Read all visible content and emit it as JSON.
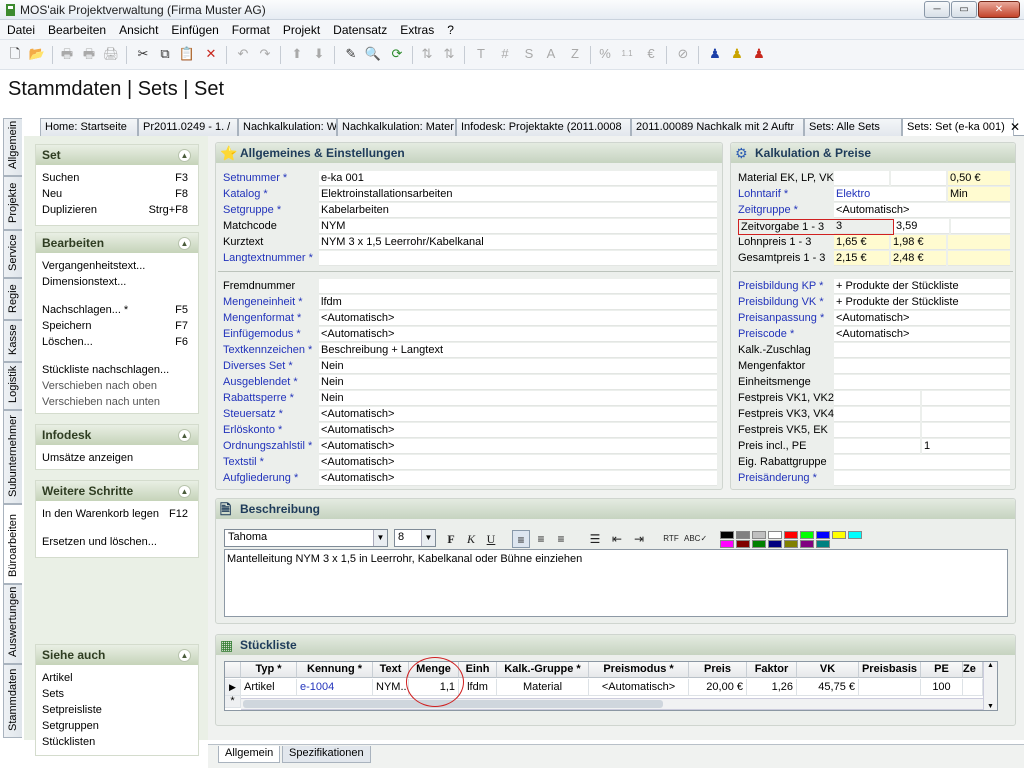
{
  "window": {
    "title": "MOS'aik Projektverwaltung (Firma Muster AG)"
  },
  "menu": [
    "Datei",
    "Bearbeiten",
    "Ansicht",
    "Einfügen",
    "Format",
    "Projekt",
    "Datensatz",
    "Extras",
    "?"
  ],
  "page": {
    "title": "Stammdaten | Sets | Set"
  },
  "tabs": [
    "Home: Startseite",
    "Pr2011.0249 - 1. /",
    "Nachkalkulation: W",
    "Nachkalkulation: Mater",
    "Infodesk: Projektakte (2011.0008",
    "2011.00089 Nachkalk mit 2 Auftr",
    "Sets: Alle Sets",
    "Sets: Set (e-ka 001)"
  ],
  "vtabs": [
    "Allgemein",
    "Projekte",
    "Service",
    "Regie",
    "Kasse",
    "Logistik",
    "Subunternehmer",
    "Büroarbeiten",
    "Auswertungen",
    "Stammdaten"
  ],
  "left": {
    "set": {
      "title": "Set",
      "items": [
        {
          "label": "Suchen",
          "key": "F3"
        },
        {
          "label": "Neu",
          "key": "F8"
        },
        {
          "label": "Duplizieren",
          "key": "Strg+F8"
        }
      ]
    },
    "bearbeiten": {
      "title": "Bearbeiten",
      "items": [
        {
          "label": "Vergangenheitstext...",
          "key": ""
        },
        {
          "label": "Dimensionstext...",
          "key": ""
        },
        {
          "label": "Nachschlagen... *",
          "key": "F5"
        },
        {
          "label": "Speichern",
          "key": "F7"
        },
        {
          "label": "Löschen...",
          "key": "F6"
        },
        {
          "label": "Stückliste nachschlagen...",
          "key": ""
        },
        {
          "label": "Verschieben nach oben",
          "key": ""
        },
        {
          "label": "Verschieben nach unten",
          "key": ""
        }
      ]
    },
    "infodesk": {
      "title": "Infodesk",
      "items": [
        {
          "label": "Umsätze anzeigen",
          "key": ""
        }
      ]
    },
    "weitere": {
      "title": "Weitere Schritte",
      "items": [
        {
          "label": "In den Warenkorb legen",
          "key": "F12"
        },
        {
          "label": "Ersetzen und löschen...",
          "key": ""
        }
      ]
    },
    "siehe": {
      "title": "Siehe auch",
      "items": [
        {
          "label": "Artikel"
        },
        {
          "label": "Sets"
        },
        {
          "label": "Setpreisliste"
        },
        {
          "label": "Setgruppen"
        },
        {
          "label": "Stücklisten"
        }
      ]
    }
  },
  "allgemein": {
    "title": "Allgemeines & Einstellungen",
    "group1": [
      {
        "label": "Setnummer *",
        "value": "e-ka 001"
      },
      {
        "label": "Katalog *",
        "value": "Elektroinstallationsarbeiten"
      },
      {
        "label": "Setgruppe *",
        "value": "Kabelarbeiten"
      },
      {
        "label": "Matchcode",
        "value": "NYM"
      },
      {
        "label": "Kurztext",
        "value": "NYM 3 x 1,5 Leerrohr/Kabelkanal"
      },
      {
        "label": "Langtextnummer *",
        "value": ""
      }
    ],
    "group2": [
      {
        "label": "Fremdnummer",
        "value": ""
      },
      {
        "label": "Mengeneinheit *",
        "value": "lfdm"
      },
      {
        "label": "Mengenformat *",
        "value": "<Automatisch>"
      },
      {
        "label": "Einfügemodus *",
        "value": "<Automatisch>"
      },
      {
        "label": "Textkennzeichen *",
        "value": "Beschreibung + Langtext"
      },
      {
        "label": "Diverses Set *",
        "value": "Nein"
      },
      {
        "label": "Ausgeblendet *",
        "value": "Nein"
      },
      {
        "label": "Rabattsperre *",
        "value": "Nein"
      },
      {
        "label": "Steuersatz *",
        "value": "<Automatisch>"
      },
      {
        "label": "Erlöskonto *",
        "value": "<Automatisch>"
      },
      {
        "label": "Ordnungszahlstil *",
        "value": "<Automatisch>"
      },
      {
        "label": "Textstil *",
        "value": "<Automatisch>"
      },
      {
        "label": "Aufgliederung *",
        "value": "<Automatisch>"
      }
    ]
  },
  "kalk": {
    "title": "Kalkulation & Preise",
    "material_label": "Material EK, LP, VK",
    "material_vk": "0,50 €",
    "lohntarif_label": "Lohntarif *",
    "lohntarif_value": "Elektro",
    "lohntarif_unit": "Min",
    "zeitgruppe_label": "Zeitgruppe *",
    "zeitgruppe_value": "<Automatisch>",
    "zeitvorgabe_label": "Zeitvorgabe 1 - 3",
    "zeitvorgabe_1": "3",
    "zeitvorgabe_2": "3,59",
    "lohnpreis_label": "Lohnpreis 1 - 3",
    "lohnpreis_1": "1,65 €",
    "lohnpreis_2": "1,98 €",
    "gesamtpreis_label": "Gesamtpreis 1 - 3",
    "gesamtpreis_1": "2,15 €",
    "gesamtpreis_2": "2,48 €",
    "group2": [
      {
        "label": "Preisbildung KP *",
        "value": "+ Produkte der Stückliste"
      },
      {
        "label": "Preisbildung VK *",
        "value": "+ Produkte der Stückliste"
      },
      {
        "label": "Preisanpassung *",
        "value": "<Automatisch>"
      },
      {
        "label": "Preiscode *",
        "value": "<Automatisch>"
      },
      {
        "label": "Kalk.-Zuschlag",
        "value": ""
      },
      {
        "label": "Mengenfaktor",
        "value": ""
      },
      {
        "label": "Einheitsmenge",
        "value": ""
      }
    ],
    "fest": [
      "Festpreis VK1, VK2",
      "Festpreis VK3, VK4",
      "Festpreis VK5, EK"
    ],
    "preis_pe_label": "Preis incl., PE",
    "preis_pe_value": "1",
    "rabattgruppe_label": "Eig. Rabattgruppe",
    "preisaenderung_label": "Preisänderung *"
  },
  "beschreibung": {
    "title": "Beschreibung",
    "font": "Tahoma",
    "size": "8",
    "text": "Mantelleitung NYM 3 x 1,5 in Leerrohr, Kabelkanal oder Bühne einziehen",
    "colors": [
      "#000000",
      "#808080",
      "#c0c0c0",
      "#ffffff",
      "#ff0000",
      "#00ff00",
      "#0000ff",
      "#ffff00",
      "#00ffff",
      "#ff00ff",
      "#800000",
      "#008000",
      "#000080",
      "#808000",
      "#800080",
      "#008080"
    ]
  },
  "stueckliste": {
    "title": "Stückliste",
    "columns": [
      "Typ *",
      "Kennung *",
      "Text",
      "Menge",
      "Einh",
      "Kalk.-Gruppe *",
      "Preismodus *",
      "Preis",
      "Faktor",
      "VK",
      "Preisbasis",
      "PE",
      "Ze"
    ],
    "row": [
      "Artikel",
      "e-1004",
      "NYM...",
      "1,1",
      "lfdm",
      "Material",
      "<Automatisch>",
      "20,00 €",
      "1,26",
      "45,75 €",
      "",
      "100",
      ""
    ]
  },
  "bottomtabs": [
    "Allgemein",
    "Spezifikationen"
  ]
}
